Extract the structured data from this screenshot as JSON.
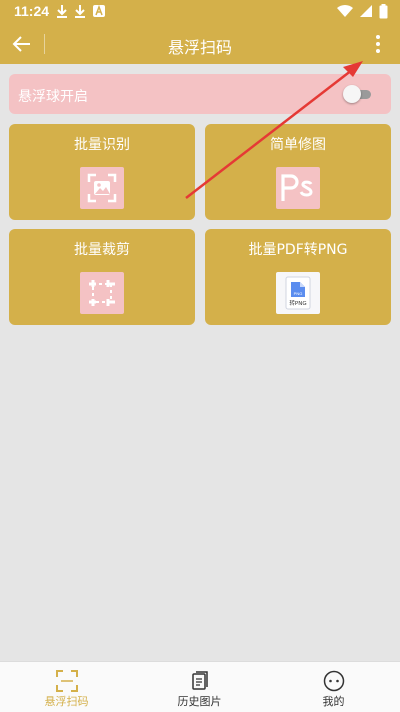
{
  "status_bar": {
    "time": "11:24"
  },
  "app_bar": {
    "title": "悬浮扫码"
  },
  "toggle": {
    "label": "悬浮球开启",
    "enabled": false
  },
  "cards": [
    {
      "label": "批量识别",
      "icon": "image-scan-icon"
    },
    {
      "label": "简单修图",
      "icon": "ps-icon"
    },
    {
      "label": "批量裁剪",
      "icon": "crop-icon"
    },
    {
      "label": "批量PDF转PNG",
      "icon": "pdf-to-png-icon",
      "icon_text": "转PNG",
      "icon_badge": "PNG"
    }
  ],
  "bottom_nav": [
    {
      "label": "悬浮扫码",
      "icon": "scan-icon",
      "active": true
    },
    {
      "label": "历史图片",
      "icon": "history-images-icon",
      "active": false
    },
    {
      "label": "我的",
      "icon": "profile-icon",
      "active": false
    }
  ],
  "colors": {
    "primary": "#d4b04a",
    "accent_pink": "#f4c2c4",
    "background": "#e5e5e5",
    "annotation_arrow": "#e53935"
  }
}
